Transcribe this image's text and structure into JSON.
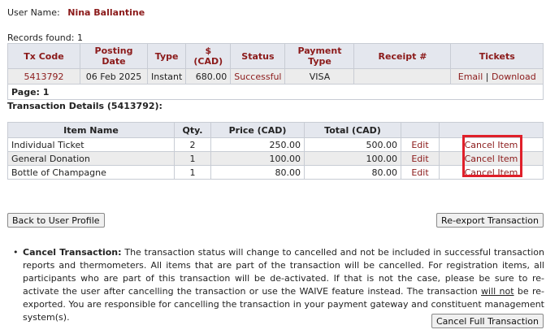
{
  "user": {
    "label": "User Name:",
    "name": "Nina Ballantine"
  },
  "records": {
    "text": "Records found: 1"
  },
  "transactions": {
    "headers": [
      "Tx Code",
      "Posting Date",
      "Type",
      "$ (CAD)",
      "Status",
      "Payment Type",
      "Receipt #",
      "Tickets"
    ],
    "row": {
      "tx_code": "5413792",
      "posting_date": "06 Feb 2025",
      "type": "Instant",
      "amount": "680.00",
      "status": "Successful",
      "payment_type": "VISA",
      "receipt": "",
      "tickets_email": "Email",
      "tickets_sep": "|",
      "tickets_download": "Download"
    },
    "page_label": "Page: 1"
  },
  "details": {
    "title": "Transaction Details (5413792):",
    "headers": [
      "Item Name",
      "Qty.",
      "Price (CAD)",
      "Total (CAD)",
      "",
      ""
    ],
    "items": [
      {
        "name": "Individual Ticket",
        "qty": "2",
        "price": "250.00",
        "total": "500.00",
        "edit": "Edit",
        "cancel": "Cancel Item"
      },
      {
        "name": "General Donation",
        "qty": "1",
        "price": "100.00",
        "total": "100.00",
        "edit": "Edit",
        "cancel": "Cancel Item"
      },
      {
        "name": "Bottle of Champagne",
        "qty": "1",
        "price": "80.00",
        "total": "80.00",
        "edit": "Edit",
        "cancel": "Cancel Item"
      }
    ],
    "highlight_color": "#e0202a"
  },
  "buttons": {
    "back": "Back to User Profile",
    "reexport": "Re-export Transaction",
    "cancel_full": "Cancel Full Transaction"
  },
  "note": {
    "bullet": "•",
    "heading": "Cancel Transaction:",
    "text_1": " The transaction status will change to cancelled and not be included in successful transaction reports and thermometers. All items that are part of the transaction will be cancelled. For registration items, all participants who are part of this transaction will be de-activated. If that is not the case, please be sure to re-activate the user after cancelling the transaction or use the WAIVE feature instead. The transaction ",
    "underlined": "will not",
    "text_2": " be re-exported. You are responsible for cancelling the transaction in your payment gateway and constituent management system(s)."
  },
  "colors": {
    "accent": "#8b1a1a",
    "header_bg": "#e4e7ee",
    "row_bg": "#ececec"
  }
}
